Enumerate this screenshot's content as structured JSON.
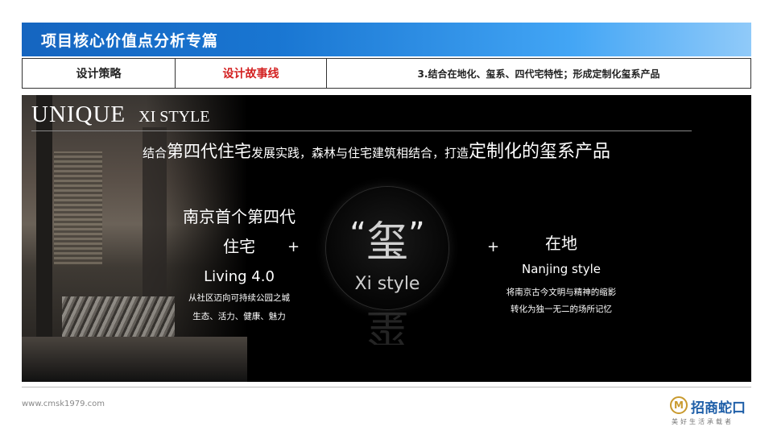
{
  "header": {
    "title": "项目核心价值点分析专篇"
  },
  "tabs": [
    {
      "label": "设计策略"
    },
    {
      "label": "设计故事线"
    },
    {
      "label": "3.结合在地化、玺系、四代宅特性；形成定制化玺系产品"
    }
  ],
  "hero": {
    "unique_big": "UNIQUE",
    "unique_small": "XI STYLE",
    "headline_part1": "结合",
    "headline_part2": "第四代住宅",
    "headline_part3": "发展实践，森林与住宅建筑相结合，打造",
    "headline_part4": "定制化的玺系产品",
    "left": {
      "line1": "南京首个第四代",
      "line2": "住宅",
      "line3": "Living 4.0",
      "line4": "从社区迈向可持续公园之城",
      "line5": "生态、活力、健康、魅力"
    },
    "plus": "+",
    "center": {
      "quote_open": "“",
      "char": "玺",
      "quote_close": "”",
      "subtitle": "Xi style"
    },
    "right": {
      "line1": "在地",
      "line2": "Nanjing style",
      "line3": "将南京古今文明与精神的缩影",
      "line4": "转化为独一无二的场所记忆"
    }
  },
  "footer": {
    "url": "www.cmsk1979.com",
    "logo_name": "招商蛇口",
    "logo_slogan": "美好生活承载者"
  },
  "colors": {
    "header_blue": "#1976d2",
    "accent_red": "#d32020",
    "logo_gold": "#c99a2e",
    "logo_blue": "#1f5fa8"
  }
}
